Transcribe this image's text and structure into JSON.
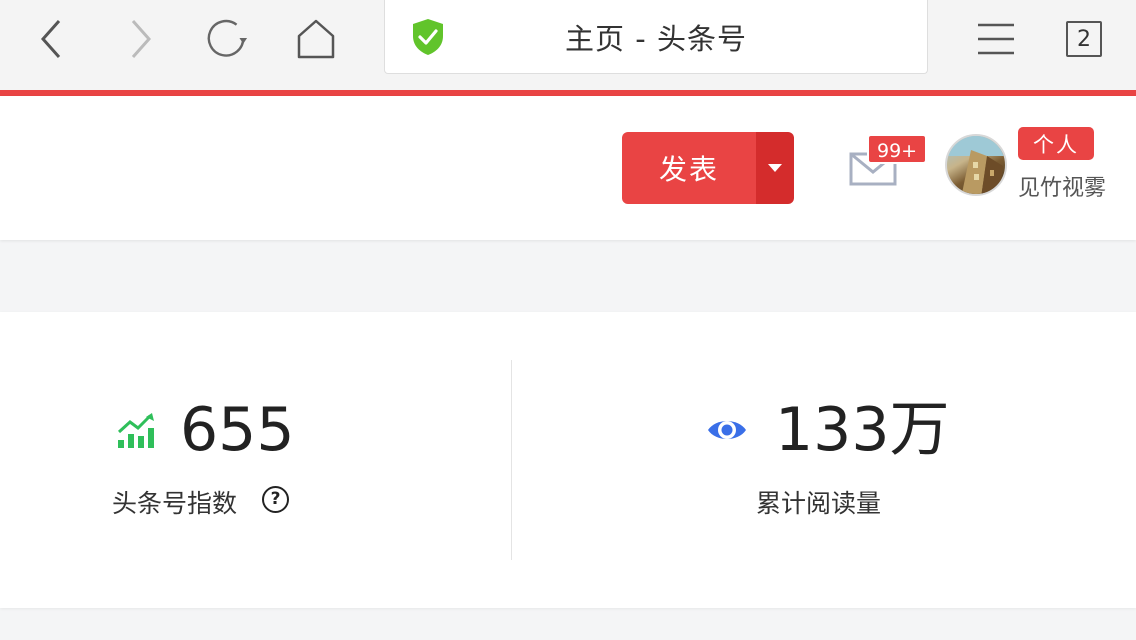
{
  "browser": {
    "address_title": "主页 - 头条号",
    "tab_count": "2",
    "icons": [
      "back-icon",
      "forward-icon",
      "reload-icon",
      "home-icon",
      "shield-check-icon",
      "menu-icon",
      "tabs-icon"
    ],
    "accent_color": "#e94444"
  },
  "header": {
    "publish_label": "发表",
    "mail_badge": "99+",
    "tag_label": "个人",
    "username": "见竹视雾"
  },
  "stats": {
    "index": {
      "value": "655",
      "label": "头条号指数",
      "help": "?",
      "icon": "trend-chart-icon",
      "icon_color": "#2fbf5a"
    },
    "reads": {
      "value": "133万",
      "label": "累计阅读量",
      "icon": "eye-icon",
      "icon_color": "#3a6fe8"
    }
  }
}
